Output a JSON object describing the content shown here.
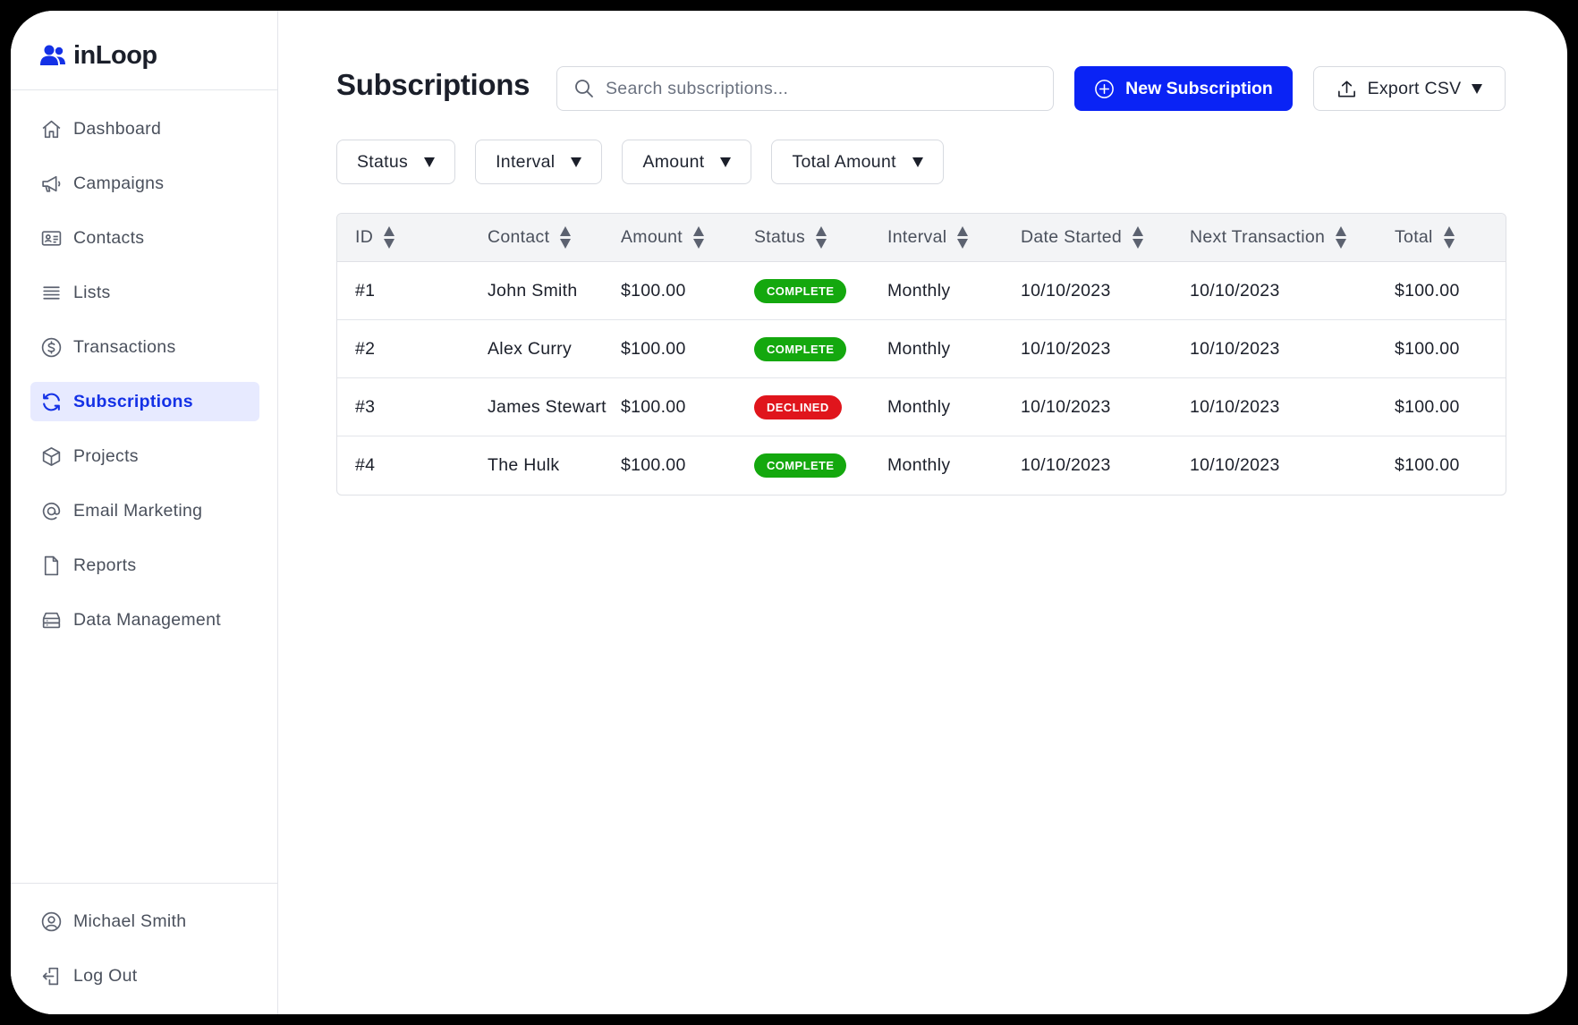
{
  "brand": {
    "name": "inLoop",
    "icon": "users-icon",
    "color": "#1431e6"
  },
  "sidebar": {
    "items": [
      {
        "label": "Dashboard",
        "icon": "home-icon"
      },
      {
        "label": "Campaigns",
        "icon": "megaphone-icon"
      },
      {
        "label": "Contacts",
        "icon": "id-card-icon"
      },
      {
        "label": "Lists",
        "icon": "list-icon"
      },
      {
        "label": "Transactions",
        "icon": "dollar-circle-icon"
      },
      {
        "label": "Subscriptions",
        "icon": "refresh-icon",
        "active": true
      },
      {
        "label": "Projects",
        "icon": "cube-icon"
      },
      {
        "label": "Email Marketing",
        "icon": "at-sign-icon"
      },
      {
        "label": "Reports",
        "icon": "file-icon"
      },
      {
        "label": "Data Management",
        "icon": "database-icon"
      }
    ],
    "bottom": [
      {
        "label": "Michael Smith",
        "icon": "user-circle-icon"
      },
      {
        "label": "Log Out",
        "icon": "logout-icon"
      }
    ]
  },
  "page": {
    "title": "Subscriptions"
  },
  "search": {
    "placeholder": "Search subscriptions...",
    "value": ""
  },
  "actions": {
    "new_label": "New Subscription",
    "export_label": "Export CSV",
    "accent": "#0a23f5"
  },
  "filters": [
    "Status",
    "Interval",
    "Amount",
    "Total Amount"
  ],
  "table": {
    "headers": [
      "ID",
      "Contact",
      "Amount",
      "Status",
      "Interval",
      "Date Started",
      "Next Transaction",
      "Total"
    ],
    "rows": [
      {
        "id": "#1",
        "contact": "John Smith",
        "amount": "$100.00",
        "status": "COMPLETE",
        "interval": "Monthly",
        "started": "10/10/2023",
        "next": "10/10/2023",
        "total": "$100.00"
      },
      {
        "id": "#2",
        "contact": "Alex Curry",
        "amount": "$100.00",
        "status": "COMPLETE",
        "interval": "Monthly",
        "started": "10/10/2023",
        "next": "10/10/2023",
        "total": "$100.00"
      },
      {
        "id": "#3",
        "contact": "James Stewart",
        "amount": "$100.00",
        "status": "DECLINED",
        "interval": "Monthly",
        "started": "10/10/2023",
        "next": "10/10/2023",
        "total": "$100.00"
      },
      {
        "id": "#4",
        "contact": "The Hulk",
        "amount": "$100.00",
        "status": "COMPLETE",
        "interval": "Monthly",
        "started": "10/10/2023",
        "next": "10/10/2023",
        "total": "$100.00"
      }
    ],
    "status_colors": {
      "COMPLETE": "#14a80e",
      "DECLINED": "#e0151c"
    }
  }
}
